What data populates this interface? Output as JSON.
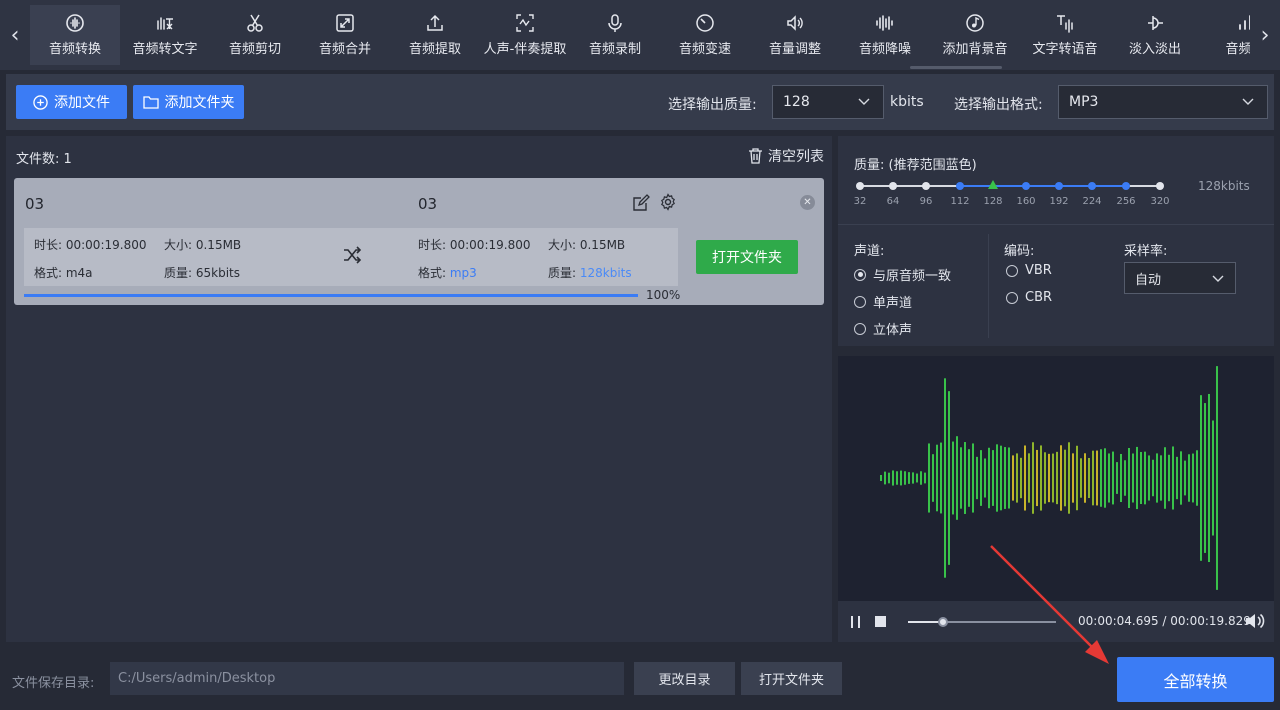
{
  "toolbar": {
    "tabs": [
      {
        "label": "音频转换",
        "icon": "waveform-circle-icon",
        "active": true
      },
      {
        "label": "音频转文字",
        "icon": "hand-text-icon"
      },
      {
        "label": "音频剪切",
        "icon": "scissors-icon"
      },
      {
        "label": "音频合并",
        "icon": "merge-icon"
      },
      {
        "label": "音频提取",
        "icon": "upload-icon"
      },
      {
        "label": "人声-伴奏提取",
        "icon": "vocal-split-icon"
      },
      {
        "label": "音频录制",
        "icon": "microphone-icon"
      },
      {
        "label": "音频变速",
        "icon": "speed-gauge-icon"
      },
      {
        "label": "音量调整",
        "icon": "volume-icon"
      },
      {
        "label": "音频降噪",
        "icon": "noise-bars-icon"
      },
      {
        "label": "添加背景音",
        "icon": "music-note-icon"
      },
      {
        "label": "文字转语音",
        "icon": "text-speech-icon"
      },
      {
        "label": "淡入淡出",
        "icon": "fade-icon"
      },
      {
        "label": "音频多",
        "icon": "bars-icon"
      }
    ]
  },
  "actions": {
    "add_file": "添加文件",
    "add_folder": "添加文件夹",
    "quality_label": "选择输出质量:",
    "quality_value": "128",
    "quality_unit": "kbits",
    "format_label": "选择输出格式:",
    "format_value": "MP3"
  },
  "filelist": {
    "count_label": "文件数: 1",
    "clear_label": "清空列表",
    "item": {
      "src_name": "03",
      "dst_name": "03",
      "src_duration": "时长: 00:00:19.800",
      "src_size": "大小: 0.15MB",
      "src_format_label": "格式: ",
      "src_format": "m4a",
      "src_quality_label": "质量: ",
      "src_quality": "65kbits",
      "dst_duration": "时长: 00:00:19.800",
      "dst_size": "大小: 0.15MB",
      "dst_format_label": "格式: ",
      "dst_format": "mp3",
      "dst_quality_label": "质量: ",
      "dst_quality": "128kbits",
      "progress": 100,
      "progress_label": "100%",
      "open_folder": "打开文件夹"
    }
  },
  "quality_panel": {
    "title": "质量: (推荐范围蓝色)",
    "ticks": [
      "32",
      "64",
      "96",
      "112",
      "128",
      "160",
      "192",
      "224",
      "256",
      "320"
    ],
    "selected": "128",
    "current_label": "128kbits"
  },
  "channel": {
    "title": "声道:",
    "options": [
      "与原音频一致",
      "单声道",
      "立体声"
    ],
    "selected": 0
  },
  "encoding": {
    "title": "编码:",
    "options": [
      "VBR",
      "CBR"
    ]
  },
  "samplerate": {
    "title": "采样率:",
    "value": "自动"
  },
  "player": {
    "time": "00:00:04.695 / 00:00:19.829",
    "position": 0.237
  },
  "bottom": {
    "save_label": "文件保存目录:",
    "save_path": "C:/Users/admin/Desktop",
    "change_dir": "更改目录",
    "open_folder": "打开文件夹",
    "convert_all": "全部转换"
  },
  "colors": {
    "accent": "#3b7cf5",
    "green": "#2faa4a",
    "wave_green": "#39c24a",
    "wave_yellow": "#c9b42a"
  }
}
